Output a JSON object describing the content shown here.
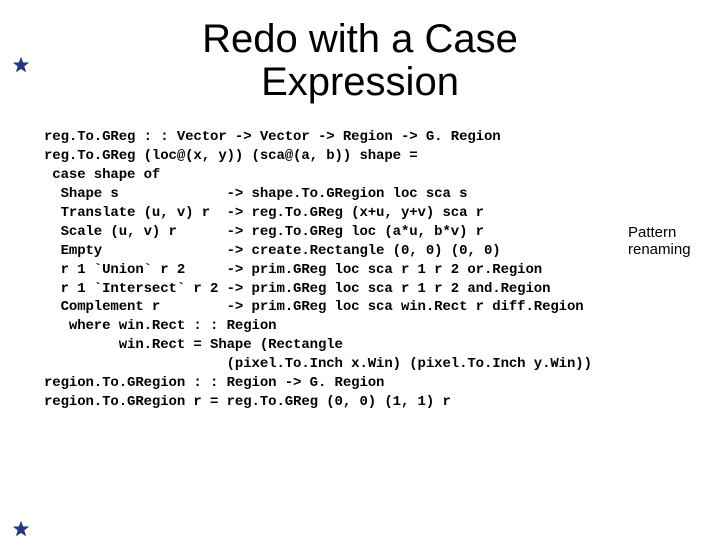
{
  "title_line1": "Redo with a Case",
  "title_line2": "Expression",
  "code": "reg.To.GReg : : Vector -> Vector -> Region -> G. Region\nreg.To.GReg (loc@(x, y)) (sca@(a, b)) shape =\n case shape of\n  Shape s             -> shape.To.GRegion loc sca s\n  Translate (u, v) r  -> reg.To.GReg (x+u, y+v) sca r\n  Scale (u, v) r      -> reg.To.GReg loc (a*u, b*v) r\n  Empty               -> create.Rectangle (0, 0) (0, 0)\n  r 1 `Union` r 2     -> prim.GReg loc sca r 1 r 2 or.Region\n  r 1 `Intersect` r 2 -> prim.GReg loc sca r 1 r 2 and.Region\n  Complement r        -> prim.GReg loc sca win.Rect r diff.Region\n   where win.Rect : : Region\n         win.Rect = Shape (Rectangle\n                      (pixel.To.Inch x.Win) (pixel.To.Inch y.Win))\nregion.To.GRegion : : Region -> G. Region\nregion.To.GRegion r = reg.To.GReg (0, 0) (1, 1) r",
  "annotation_line1": "Pattern",
  "annotation_line2": "renaming"
}
